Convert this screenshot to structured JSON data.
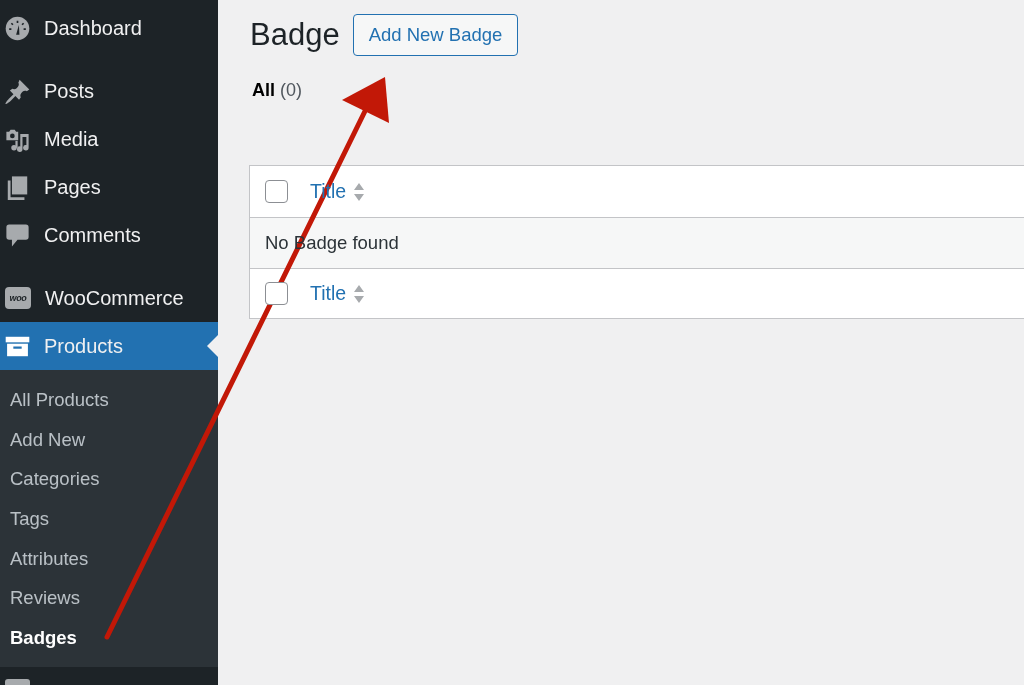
{
  "sidebar": {
    "groups": [
      {
        "items": [
          {
            "label": "Dashboard",
            "selected": false
          }
        ]
      },
      {
        "items": [
          {
            "label": "Posts",
            "selected": false
          },
          {
            "label": "Media",
            "selected": false
          },
          {
            "label": "Pages",
            "selected": false
          },
          {
            "label": "Comments",
            "selected": false
          }
        ]
      },
      {
        "items": [
          {
            "label": "WooCommerce",
            "logo_text": "woo",
            "selected": false
          },
          {
            "label": "Products",
            "selected": true,
            "submenu": [
              {
                "label": "All Products",
                "selected": false
              },
              {
                "label": "Add New",
                "selected": false
              },
              {
                "label": "Categories",
                "selected": false
              },
              {
                "label": "Tags",
                "selected": false
              },
              {
                "label": "Attributes",
                "selected": false
              },
              {
                "label": "Reviews",
                "selected": false
              },
              {
                "label": "Badges",
                "selected": true
              }
            ]
          }
        ]
      }
    ]
  },
  "page": {
    "title": "Badge",
    "add_button": "Add New Badge"
  },
  "views": [
    {
      "label": "All",
      "count": "(0)",
      "selected": true
    }
  ],
  "table": {
    "header": {
      "checked": false,
      "columns": [
        {
          "label": "Title",
          "sortable": true
        }
      ]
    },
    "empty_message": "No Badge found",
    "footer": {
      "checked": false,
      "columns": [
        {
          "label": "Title",
          "sortable": true
        }
      ]
    }
  }
}
